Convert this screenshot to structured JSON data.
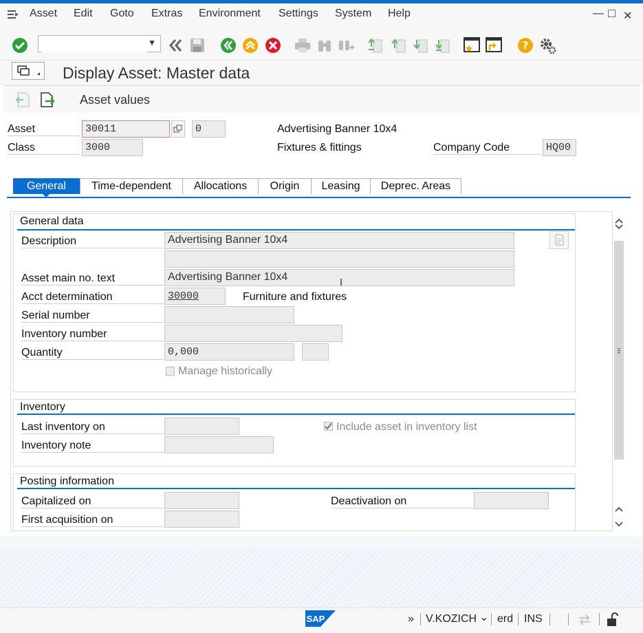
{
  "menu": {
    "items": [
      "Asset",
      "Edit",
      "Goto",
      "Extras",
      "Environment",
      "Settings",
      "System",
      "Help"
    ]
  },
  "window_controls": {
    "minimize": "—",
    "maximize": "□",
    "close": "✕"
  },
  "title": "Display Asset:  Master data",
  "app_toolbar": {
    "asset_values": "Asset values"
  },
  "header": {
    "asset_label": "Asset",
    "asset_value": "30011",
    "sub_number": "0",
    "asset_description": "Advertising Banner 10x4",
    "class_label": "Class",
    "class_value": "3000",
    "class_description": "Fixtures & fittings",
    "company_code_label": "Company Code",
    "company_code_value": "HQ00"
  },
  "tabs": [
    "General",
    "Time-dependent",
    "Allocations",
    "Origin",
    "Leasing",
    "Deprec. Areas"
  ],
  "general_data": {
    "title": "General data",
    "description_label": "Description",
    "description_value": "Advertising Banner 10x4",
    "description_value2": "",
    "main_text_label": "Asset main no. text",
    "main_text_value": "Advertising Banner 10x4",
    "acct_det_label": "Acct determination",
    "acct_det_value": "30000",
    "acct_det_text": "Furniture and fixtures",
    "serial_label": "Serial number",
    "serial_value": "",
    "inventory_no_label": "Inventory number",
    "inventory_no_value": "",
    "quantity_label": "Quantity",
    "quantity_value": "0,000",
    "quantity_unit": "",
    "manage_hist_label": "Manage historically"
  },
  "inventory": {
    "title": "Inventory",
    "last_inv_label": "Last inventory on",
    "last_inv_value": "",
    "include_label": "Include asset in inventory list",
    "note_label": "Inventory note",
    "note_value": ""
  },
  "posting": {
    "title": "Posting information",
    "capitalized_label": "Capitalized on",
    "capitalized_value": "",
    "deactivation_label": "Deactivation on",
    "deactivation_value": "",
    "first_acq_label": "First acquisition on",
    "first_acq_value": ""
  },
  "status": {
    "logo": "SAP",
    "more": "»",
    "user": "V.KOZICH",
    "client_dropdown": "⌄",
    "transaction": "erd",
    "mode": "INS"
  },
  "colors": {
    "accent": "#0a6ed1",
    "ok_green": "#2e9e3e",
    "cancel_red": "#d32030",
    "warn_orange": "#f0ab00"
  }
}
